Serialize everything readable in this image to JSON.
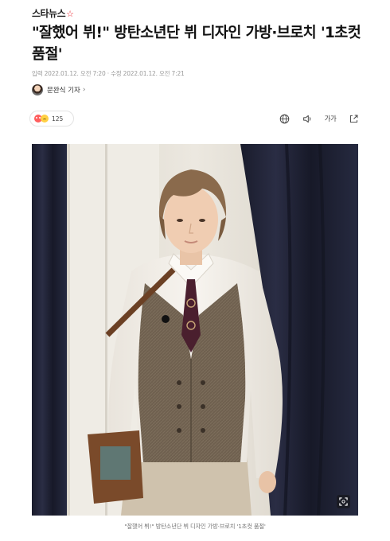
{
  "site": {
    "logo_text": "스타뉴스",
    "logo_mark": "☆",
    "accent_color": "#e8202a"
  },
  "article": {
    "headline": "\"잘했어 뷔!\" 방탄소년단 뷔 디자인 가방·브로치 '1초컷 품절'",
    "dateline": "입력 2022.01.12. 오전 7:20 · 수정 2022.01.12. 오전 7:21",
    "reporter_name": "문완식 기자",
    "reporter_chevron": "›"
  },
  "reactions": {
    "icons": [
      "like-emoji",
      "sad-emoji"
    ],
    "count": "125"
  },
  "toolbar": {
    "icons": [
      "globe-icon",
      "speaker-icon",
      "font-size-icon",
      "share-icon"
    ],
    "font_size_label": "가가"
  },
  "photo": {
    "caption": "\"잘했어 뷔!\" 방탄소년단 뷔 디자인 가방·브로치 '1초컷 품절'",
    "zoom_icon": "expand-icon"
  }
}
